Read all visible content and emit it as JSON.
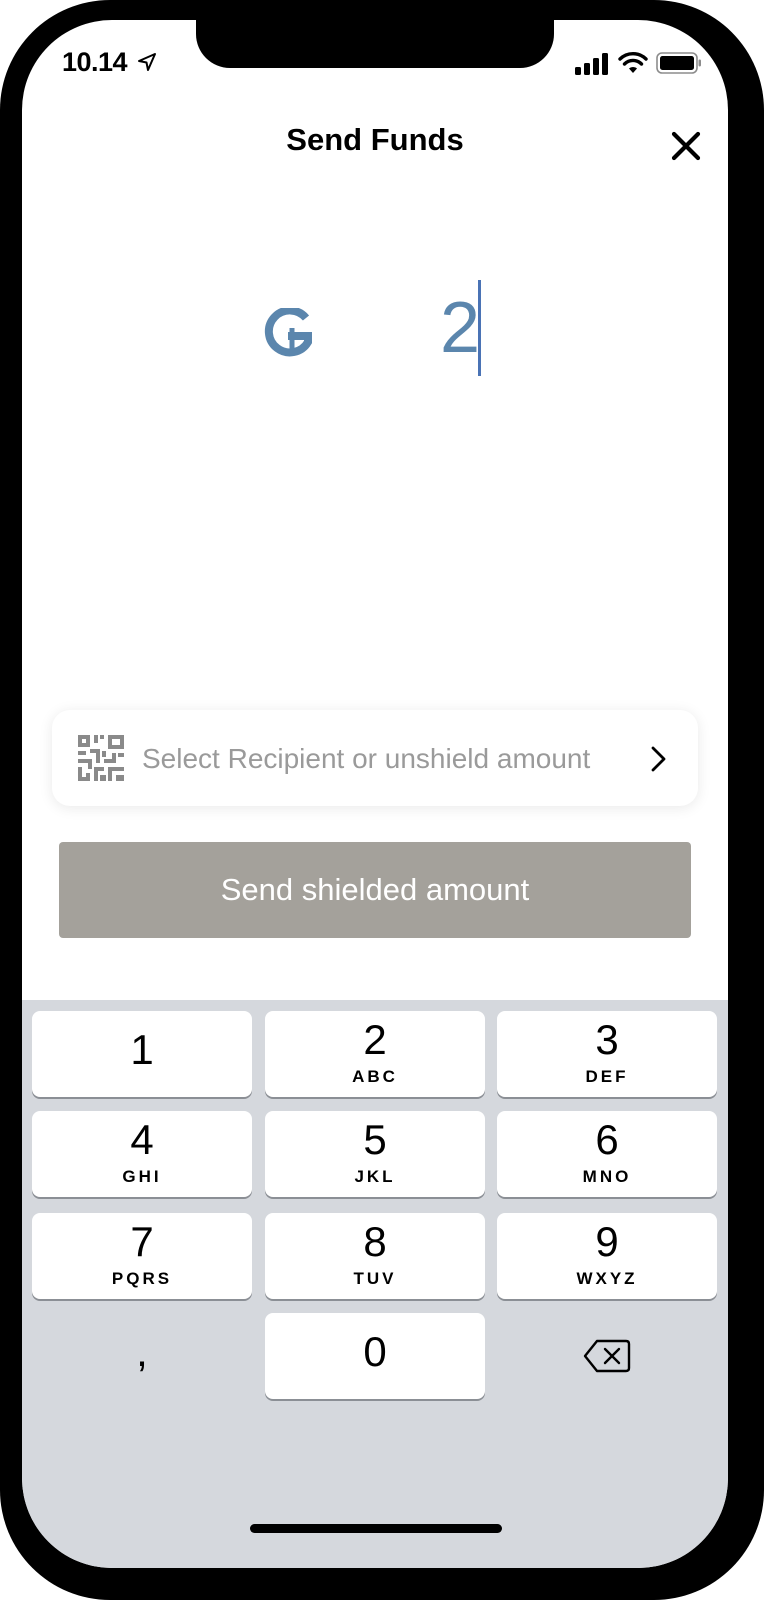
{
  "status_bar": {
    "time": "10.14"
  },
  "header": {
    "title": "Send Funds"
  },
  "amount": {
    "currency_symbol_icon": "gtu-currency-icon",
    "value": "2"
  },
  "recipient": {
    "placeholder": "Select Recipient or unshield amount",
    "icon": "qr-code-icon"
  },
  "send_button": {
    "label": "Send shielded amount"
  },
  "keypad": {
    "keys": [
      {
        "digit": "1",
        "letters": ""
      },
      {
        "digit": "2",
        "letters": "ABC"
      },
      {
        "digit": "3",
        "letters": "DEF"
      },
      {
        "digit": "4",
        "letters": "GHI"
      },
      {
        "digit": "5",
        "letters": "JKL"
      },
      {
        "digit": "6",
        "letters": "MNO"
      },
      {
        "digit": "7",
        "letters": "PQRS"
      },
      {
        "digit": "8",
        "letters": "TUV"
      },
      {
        "digit": "9",
        "letters": "WXYZ"
      },
      {
        "digit": ",",
        "letters": ""
      },
      {
        "digit": "0",
        "letters": ""
      }
    ],
    "delete_icon": "backspace-icon"
  },
  "colors": {
    "amount": "#5b86ad",
    "send_button_bg": "#a4a19b",
    "keyboard_bg": "#d5d8dd"
  }
}
